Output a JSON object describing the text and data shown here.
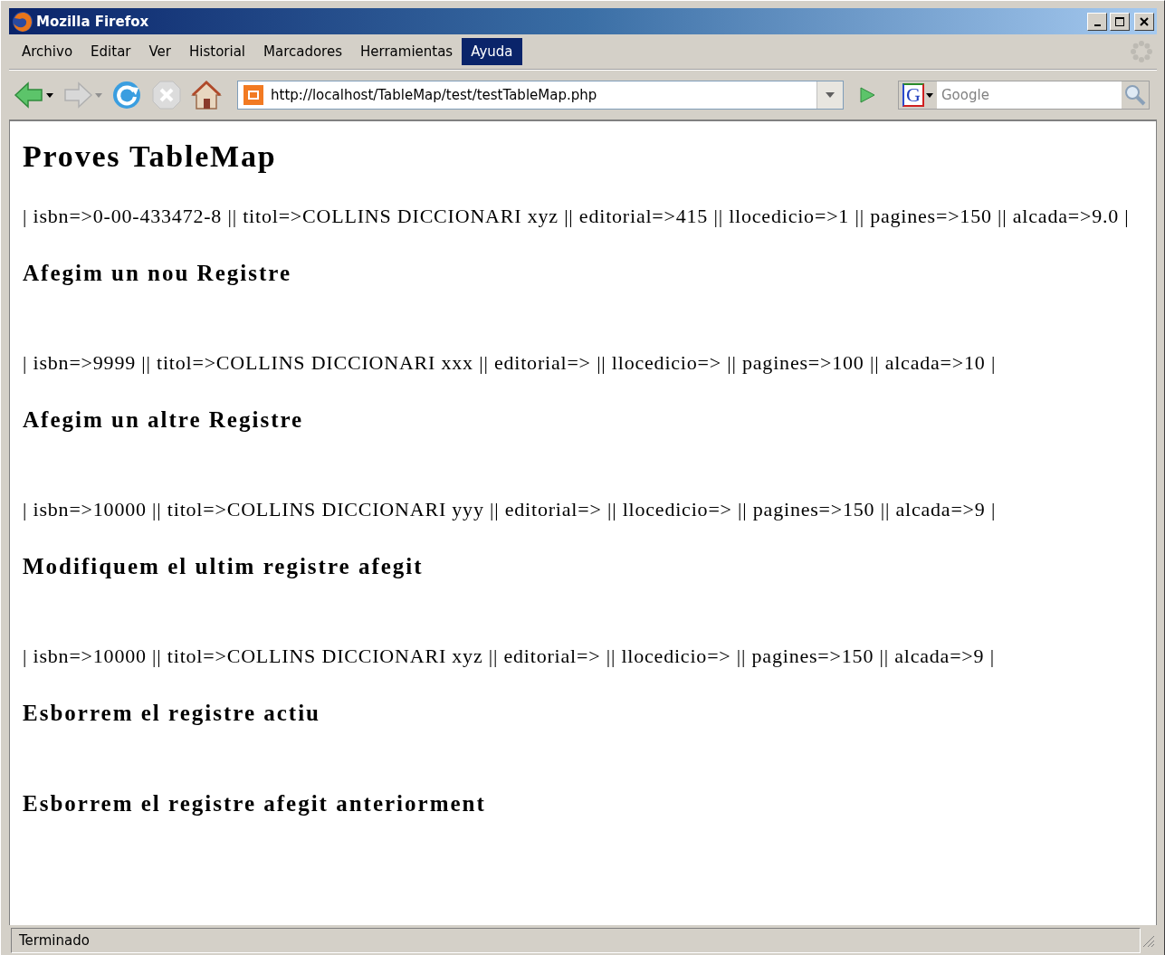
{
  "window": {
    "title": "Mozilla Firefox"
  },
  "menu": [
    {
      "label": "Archivo",
      "selected": false
    },
    {
      "label": "Editar",
      "selected": false
    },
    {
      "label": "Ver",
      "selected": false
    },
    {
      "label": "Historial",
      "selected": false
    },
    {
      "label": "Marcadores",
      "selected": false
    },
    {
      "label": "Herramientas",
      "selected": false
    },
    {
      "label": "Ayuda",
      "selected": true
    }
  ],
  "address": {
    "value": "http://localhost/TableMap/test/testTableMap.php"
  },
  "search": {
    "engine": "G",
    "placeholder": "Google"
  },
  "content": [
    {
      "kind": "title",
      "text": "Proves TableMap"
    },
    {
      "kind": "record",
      "text": "| isbn=>0-00-433472-8 || titol=>COLLINS DICCIONARI xyz || editorial=>415 || llocedicio=>1 || pagines=>150 || alcada=>9.0 |"
    },
    {
      "kind": "heading",
      "text": "Afegim un nou Registre"
    },
    {
      "kind": "record",
      "text": "| isbn=>9999 || titol=>COLLINS DICCIONARI xxx || editorial=> || llocedicio=> || pagines=>100 || alcada=>10 |"
    },
    {
      "kind": "heading",
      "text": "Afegim un altre Registre"
    },
    {
      "kind": "record",
      "text": "| isbn=>10000 || titol=>COLLINS DICCIONARI yyy || editorial=> || llocedicio=> || pagines=>150 || alcada=>9 |"
    },
    {
      "kind": "heading",
      "text": "Modifiquem el ultim registre afegit"
    },
    {
      "kind": "record",
      "text": "| isbn=>10000 || titol=>COLLINS DICCIONARI xyz || editorial=> || llocedicio=> || pagines=>150 || alcada=>9 |"
    },
    {
      "kind": "heading",
      "text": "Esborrem el registre actiu"
    },
    {
      "kind": "heading",
      "text": "Esborrem el registre afegit anteriorment"
    }
  ],
  "status_bar": {
    "text": "Terminado"
  }
}
